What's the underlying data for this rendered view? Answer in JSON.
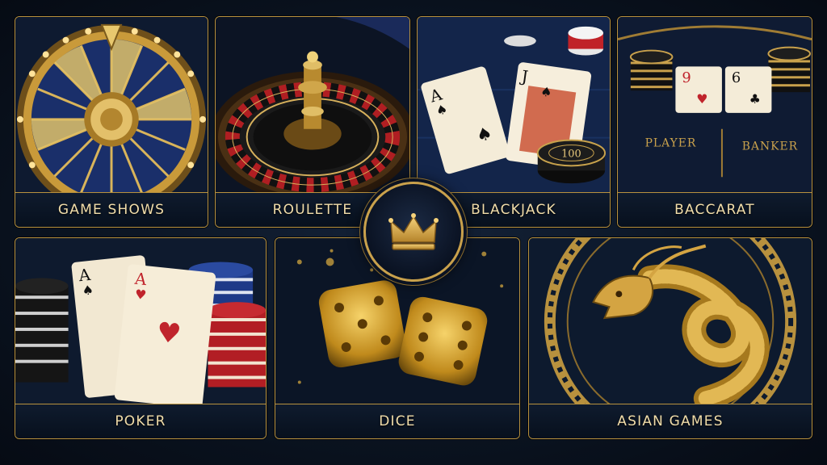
{
  "tiles": {
    "game_shows": {
      "label": "GAME SHOWS",
      "icon": "prize-wheel-icon"
    },
    "roulette": {
      "label": "ROULETTE",
      "icon": "roulette-wheel-icon"
    },
    "blackjack": {
      "label": "BLACKJACK",
      "icon": "playing-cards-icon",
      "chip_value": "100",
      "card_ranks": [
        "A",
        "J"
      ]
    },
    "baccarat": {
      "label": "BACCARAT",
      "icon": "baccarat-table-icon",
      "card_ranks": [
        "9",
        "6"
      ],
      "table_labels": [
        "PLAYER",
        "BANKER"
      ]
    },
    "poker": {
      "label": "POKER",
      "icon": "poker-cards-icon",
      "card_ranks": [
        "A",
        "A"
      ]
    },
    "dice": {
      "label": "DICE",
      "icon": "dice-icon"
    },
    "asian_games": {
      "label": "ASIAN GAMES",
      "icon": "dragon-icon"
    }
  },
  "center_badge": {
    "icon": "crown-icon"
  },
  "colors": {
    "gold": "#c9a14c",
    "navy": "#0d1a2e",
    "label_text": "#f1ddaa",
    "card_red": "#c0242c"
  }
}
